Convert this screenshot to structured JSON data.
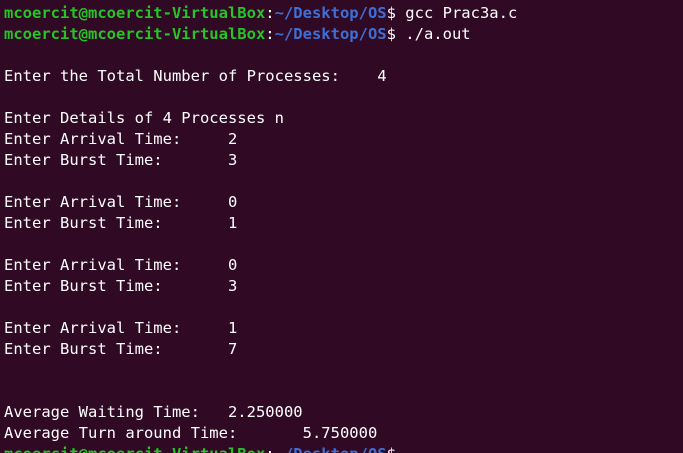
{
  "terminal": {
    "colors": {
      "background": "#300a24",
      "text": "#ffffff",
      "user_host": "#26c426",
      "path": "#3f6fd6"
    },
    "prompt": {
      "user_host": "mcoercit@mcoercit-VirtualBox",
      "separator": ":",
      "path": "~/Desktop/OS",
      "symbol": "$"
    },
    "commands": [
      " gcc Prac3a.c",
      " ./a.out"
    ],
    "output": [
      "",
      "Enter the Total Number of Processes:    4",
      "",
      "Enter Details of 4 Processes n",
      "Enter Arrival Time:     2",
      "Enter Burst Time:       3",
      "",
      "Enter Arrival Time:     0",
      "Enter Burst Time:       1",
      "",
      "Enter Arrival Time:     0",
      "Enter Burst Time:       3",
      "",
      "Enter Arrival Time:     1",
      "Enter Burst Time:       7",
      "",
      "",
      "Average Waiting Time:   2.250000",
      "Average Turn around Time:       5.750000"
    ]
  }
}
